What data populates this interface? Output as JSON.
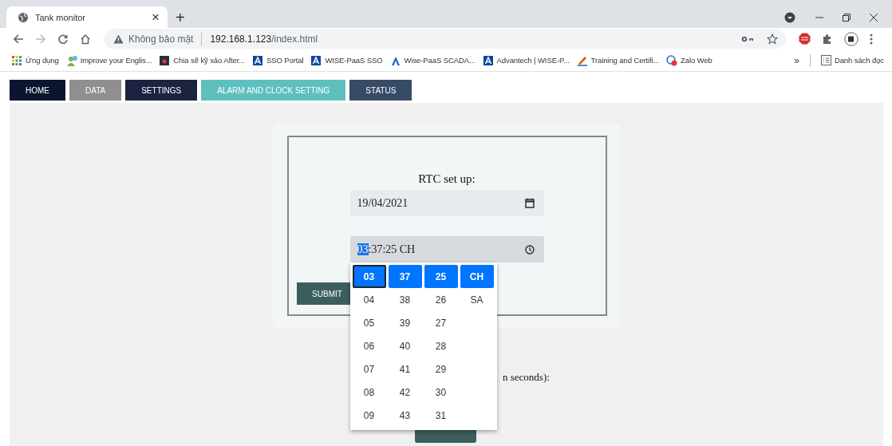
{
  "browser": {
    "tab": {
      "title": "Tank monitor",
      "close": "×"
    },
    "new_tab": "+",
    "address": {
      "security": "Không bảo mật",
      "host": "192.168.1.123",
      "path": "/index.html"
    },
    "bookmarks": [
      {
        "kind": "apps",
        "label": "Ứng dụng"
      },
      {
        "kind": "person",
        "label": "Improve your Englis..."
      },
      {
        "kind": "video",
        "label": "Chia sẽ kỹ xảo After..."
      },
      {
        "kind": "a-logo",
        "label": "SSO Portal"
      },
      {
        "kind": "a-logo",
        "label": "WISE-PaaS SSO"
      },
      {
        "kind": "peak",
        "label": "Wise-PaaS SCADA..."
      },
      {
        "kind": "a-logo",
        "label": "Advantech | WISE-P..."
      },
      {
        "kind": "pen",
        "label": "Training and Certifi..."
      },
      {
        "kind": "chat",
        "label": "Zalo Web"
      }
    ],
    "more": "»",
    "reading_list": "Danh sách đọc"
  },
  "nav": [
    {
      "label": "HOME",
      "color": "#0b1530"
    },
    {
      "label": "DATA",
      "color": "#8f8f8f"
    },
    {
      "label": "SETTINGS",
      "color": "#1c2340"
    },
    {
      "label": "ALARM AND CLOCK SETTING",
      "color": "#5fbfbe"
    },
    {
      "label": "STATUS",
      "color": "#384b66"
    }
  ],
  "rtc": {
    "title": "RTC set up:",
    "date": "19/04/2021",
    "time_segments": [
      {
        "text": "03",
        "selected": true
      },
      {
        "text": ":37:25 CH",
        "selected": false
      }
    ],
    "submit": "SUBMIT"
  },
  "picker": {
    "columns": [
      {
        "focused": true,
        "items": [
          {
            "label": "03",
            "selected": true
          },
          {
            "label": "04",
            "selected": false
          },
          {
            "label": "05",
            "selected": false
          },
          {
            "label": "06",
            "selected": false
          },
          {
            "label": "07",
            "selected": false
          },
          {
            "label": "08",
            "selected": false
          },
          {
            "label": "09",
            "selected": false
          }
        ]
      },
      {
        "focused": false,
        "items": [
          {
            "label": "37",
            "selected": true
          },
          {
            "label": "38",
            "selected": false
          },
          {
            "label": "39",
            "selected": false
          },
          {
            "label": "40",
            "selected": false
          },
          {
            "label": "41",
            "selected": false
          },
          {
            "label": "42",
            "selected": false
          },
          {
            "label": "43",
            "selected": false
          }
        ]
      },
      {
        "focused": false,
        "items": [
          {
            "label": "25",
            "selected": true
          },
          {
            "label": "26",
            "selected": false
          },
          {
            "label": "27",
            "selected": false
          },
          {
            "label": "28",
            "selected": false
          },
          {
            "label": "29",
            "selected": false
          },
          {
            "label": "30",
            "selected": false
          },
          {
            "label": "31",
            "selected": false
          }
        ]
      },
      {
        "focused": false,
        "items": [
          {
            "label": "CH",
            "selected": true
          },
          {
            "label": "SA",
            "selected": false
          }
        ]
      }
    ]
  },
  "alarm": {
    "label": "n seconds):"
  }
}
